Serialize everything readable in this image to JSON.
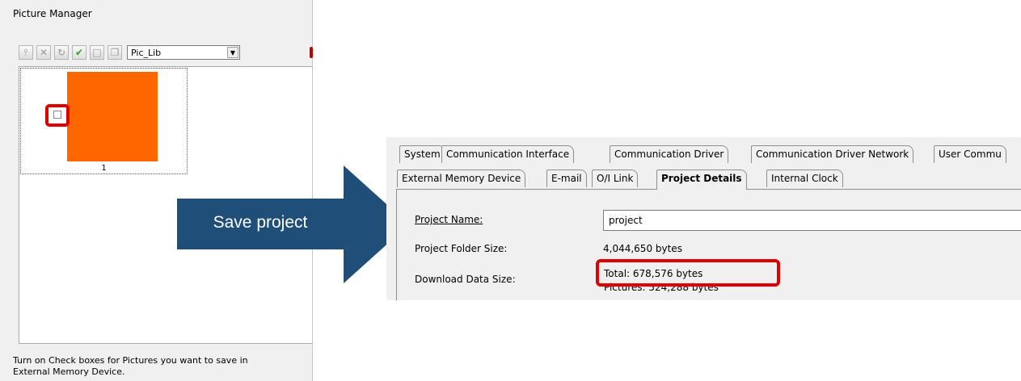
{
  "picture_manager": {
    "title": "Picture Manager",
    "toolbar": {
      "buttons": [
        "tree-icon",
        "cut-icon",
        "refresh-icon",
        "checkmark-icon",
        "uncheck-icon",
        "copy-icon"
      ],
      "library": "Pic_Lib"
    },
    "thumbnail": {
      "label": "1",
      "color": "#ff6600",
      "checked": false
    },
    "help_line1": "Turn on Check boxes for Pictures you want to save in",
    "help_line2": "External Memory Device."
  },
  "arrow": {
    "label": "Save project",
    "color": "#1f4e79"
  },
  "system": {
    "tabs_row1": [
      "System",
      "Communication Interface",
      "Communication Driver",
      "Communication Driver Network",
      "User Commu"
    ],
    "tabs_row2": [
      "External Memory Device",
      "E-mail",
      "O/I Link",
      "Project Details",
      "Internal Clock"
    ],
    "active_tab": "Project Details",
    "project_name_label": "Project Name:",
    "project_name_value": "project",
    "folder_size_label": "Project Folder Size:",
    "folder_size_value": "4,044,650 bytes",
    "download_size_label": "Download Data Size:",
    "download_total": "Total: 678,576 bytes",
    "download_pictures": "Pictures: 524,288 bytes"
  },
  "highlight_color": "#e00000"
}
